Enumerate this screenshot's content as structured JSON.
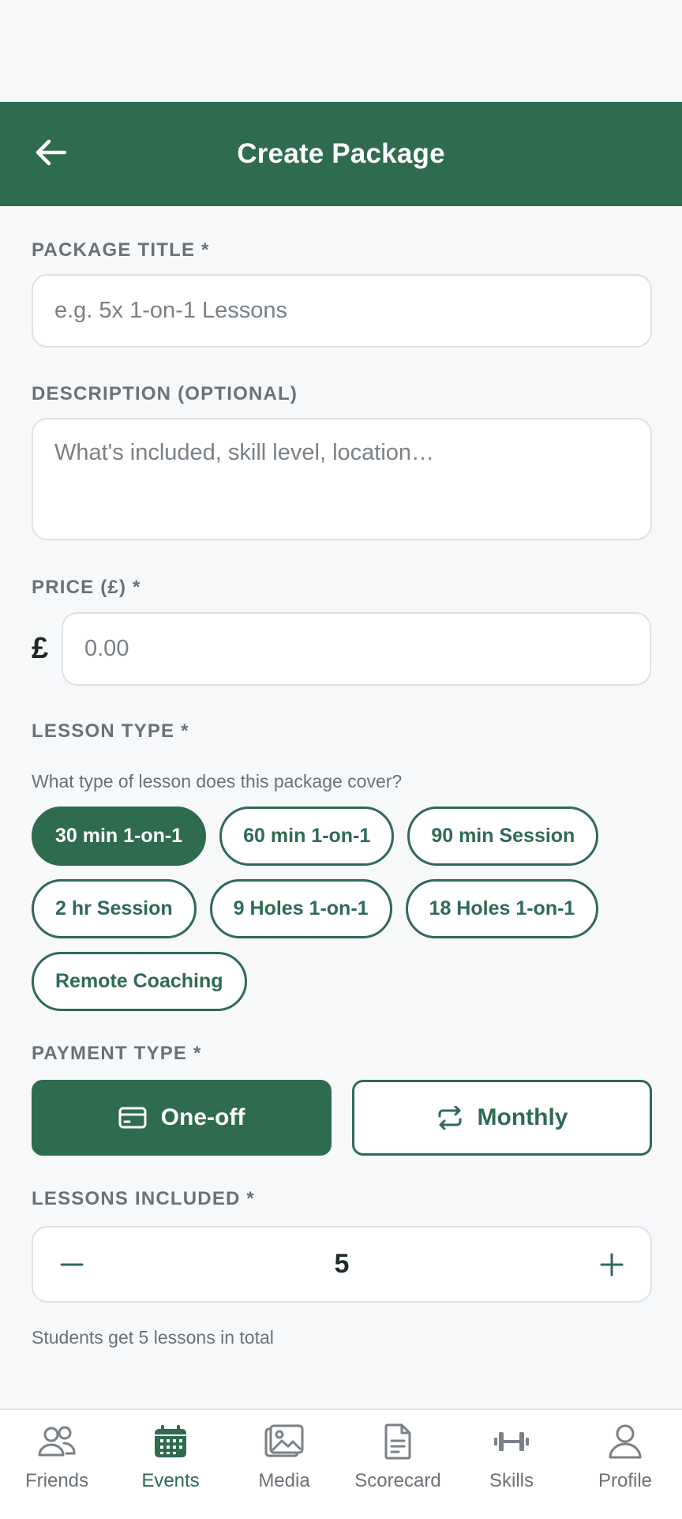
{
  "header": {
    "title": "Create Package",
    "back_icon": "arrow-left-icon"
  },
  "package_title": {
    "label": "PACKAGE TITLE *",
    "placeholder": "e.g. 5x 1-on-1 Lessons",
    "value": ""
  },
  "description": {
    "label": "DESCRIPTION (OPTIONAL)",
    "placeholder": "What's included, skill level, location…",
    "value": ""
  },
  "price": {
    "label": "PRICE (£) *",
    "currency_symbol": "£",
    "placeholder": "0.00",
    "value": ""
  },
  "lesson_type": {
    "label": "LESSON TYPE *",
    "helper": "What type of lesson does this package cover?",
    "options": [
      "30 min 1-on-1",
      "60 min 1-on-1",
      "90 min Session",
      "2 hr Session",
      "9 Holes 1-on-1",
      "18 Holes 1-on-1",
      "Remote Coaching"
    ],
    "selected": "30 min 1-on-1"
  },
  "payment_type": {
    "label": "PAYMENT TYPE *",
    "options": [
      {
        "label": "One-off",
        "icon": "credit-card-icon",
        "selected": true
      },
      {
        "label": "Monthly",
        "icon": "repeat-icon",
        "selected": false
      }
    ]
  },
  "lessons_included": {
    "label": "LESSONS INCLUDED *",
    "value": "5",
    "helper": "Students get 5 lessons in total"
  },
  "bottom_nav": {
    "items": [
      {
        "label": "Friends",
        "icon": "friends-icon",
        "active": false
      },
      {
        "label": "Events",
        "icon": "calendar-icon",
        "active": true
      },
      {
        "label": "Media",
        "icon": "image-icon",
        "active": false
      },
      {
        "label": "Scorecard",
        "icon": "document-icon",
        "active": false
      },
      {
        "label": "Skills",
        "icon": "dumbbell-icon",
        "active": false
      },
      {
        "label": "Profile",
        "icon": "user-icon",
        "active": false
      }
    ]
  },
  "colors": {
    "brand": "#2f6b4f",
    "background": "#f6f8fa",
    "muted_text": "#6b7177"
  }
}
